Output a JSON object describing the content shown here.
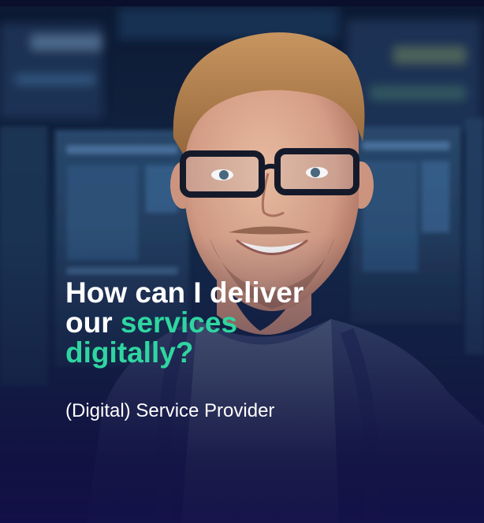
{
  "hero": {
    "headline": {
      "part1": "How can I deliver",
      "part2": "our ",
      "highlight1": "services",
      "highlight2": "digitally?"
    },
    "subtitle": "(Digital) Service Provider"
  },
  "colors": {
    "background": "#0d1433",
    "highlight": "#2fd6a0",
    "text": "#ffffff"
  }
}
